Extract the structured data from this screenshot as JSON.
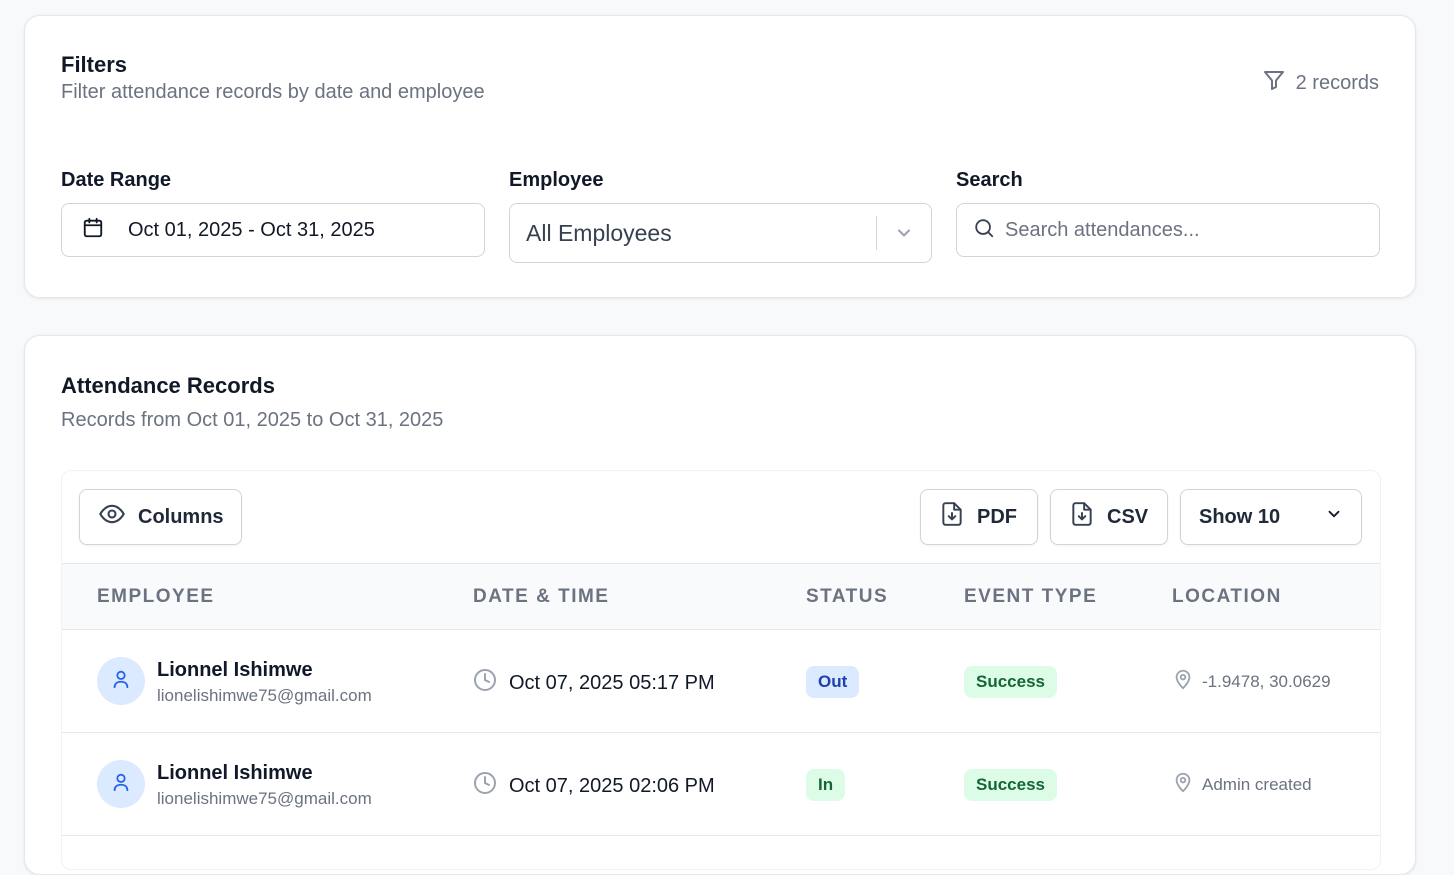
{
  "filters": {
    "title": "Filters",
    "subtitle": "Filter attendance records by date and employee",
    "records_count": "2 records",
    "date_range": {
      "label": "Date Range",
      "value": "Oct 01, 2025 - Oct 31, 2025"
    },
    "employee": {
      "label": "Employee",
      "value": "All Employees"
    },
    "search": {
      "label": "Search",
      "placeholder": "Search attendances..."
    }
  },
  "records": {
    "title": "Attendance Records",
    "subtitle": "Records from Oct 01, 2025 to Oct 31, 2025",
    "toolbar": {
      "columns_label": "Columns",
      "pdf_label": "PDF",
      "csv_label": "CSV",
      "show_label": "Show 10"
    },
    "headers": [
      "EMPLOYEE",
      "DATE & TIME",
      "STATUS",
      "EVENT TYPE",
      "LOCATION"
    ],
    "rows": [
      {
        "name": "Lionnel Ishimwe",
        "email": "lionelishimwe75@gmail.com",
        "datetime": "Oct 07, 2025 05:17 PM",
        "status": "Out",
        "event_type": "Success",
        "location": "-1.9478, 30.0629"
      },
      {
        "name": "Lionnel Ishimwe",
        "email": "lionelishimwe75@gmail.com",
        "datetime": "Oct 07, 2025 02:06 PM",
        "status": "In",
        "event_type": "Success",
        "location": "Admin created"
      }
    ]
  },
  "colors": {
    "status_out_bg": "#dbeafe",
    "status_out_fg": "#1e40af",
    "status_in_bg": "#dcfce7",
    "status_in_fg": "#166534",
    "success_bg": "#dcfce7",
    "success_fg": "#166534"
  },
  "icons": [
    "filter-icon",
    "calendar-icon",
    "chevron-down-icon",
    "search-icon",
    "eye-icon",
    "file-download-icon",
    "user-icon",
    "clock-icon",
    "map-pin-icon"
  ]
}
